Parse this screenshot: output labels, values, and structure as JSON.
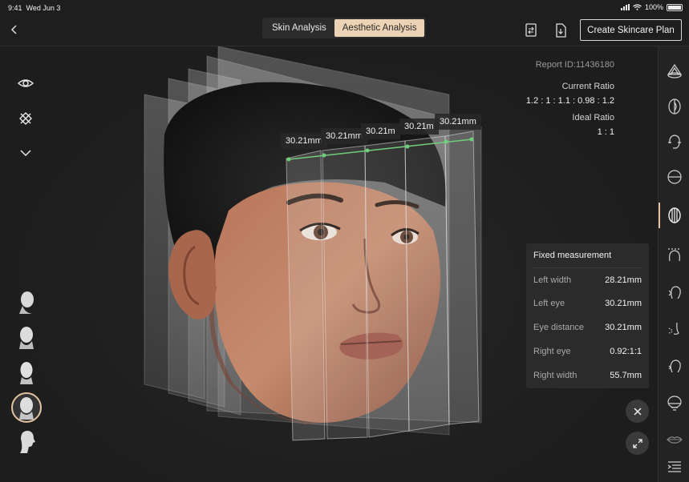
{
  "status_bar": {
    "time": "9:41",
    "date": "Wed Jun 3",
    "battery": "100%"
  },
  "header": {
    "back_icon": "chevron-left-icon",
    "tabs": [
      {
        "label": "Skin Analysis",
        "active": false
      },
      {
        "label": "Aesthetic Analysis",
        "active": true
      }
    ],
    "icons": [
      "compare-icon",
      "export-icon"
    ],
    "cta_label": "Create Skincare Plan"
  },
  "left_tools": [
    "eye-icon",
    "grid-toggle-icon",
    "chevron-down-icon"
  ],
  "head_views": [
    "head-view-front",
    "head-view-left",
    "head-view-right",
    "head-view-three-quarter",
    "head-view-profile"
  ],
  "selected_head_view": 3,
  "measurements": {
    "labels": [
      "30.21mm",
      "30.21mm",
      "30.21m",
      "30.21m",
      "30.21mm"
    ]
  },
  "report": {
    "id_text": "Report ID:11436180",
    "current_ratio_label": "Current Ratio",
    "current_ratio_value": "1.2 : 1 : 1.1 : 0.98 : 1.2",
    "ideal_ratio_label": "Ideal Ratio",
    "ideal_ratio_value": "1 : 1"
  },
  "fixed_panel": {
    "title": "Fixed measurement",
    "rows": [
      {
        "label": "Left width",
        "value": "28.21mm"
      },
      {
        "label": "Left eye",
        "value": "30.21mm"
      },
      {
        "label": "Eye distance",
        "value": "30.21mm"
      },
      {
        "label": "Right eye",
        "value": "0.92:1:1"
      },
      {
        "label": "Right width",
        "value": "55.7mm"
      }
    ]
  },
  "right_sidebar": {
    "items": [
      "face-contour-icon",
      "face-split-icon",
      "head-side-icon",
      "face-horizontal-icon",
      "face-vertical-icon",
      "forehead-icon",
      "profile-icon",
      "nose-icon",
      "jaw-icon",
      "chin-icon",
      "lips-icon",
      "menu-icon"
    ],
    "active_index": 4
  },
  "colors": {
    "accent": "#ecd3b5",
    "measure_line": "#6fcf7a",
    "background": "#1e1e1e"
  }
}
